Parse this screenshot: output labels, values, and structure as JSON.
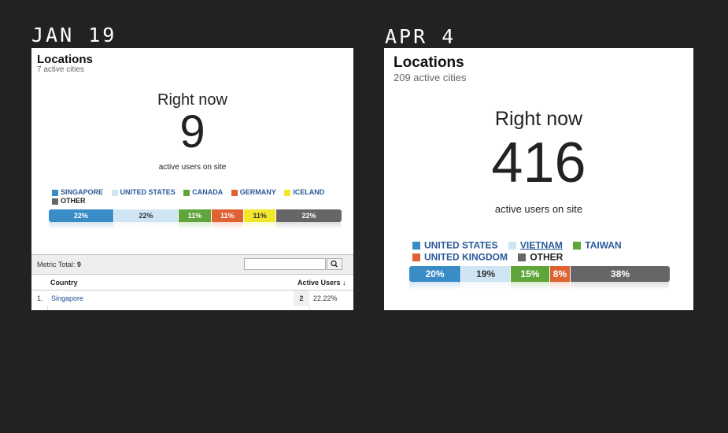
{
  "left": {
    "date": "JAN 19",
    "title": "Locations",
    "subtitle": "7 active cities",
    "right_now_title": "Right now",
    "right_now_value": "9",
    "right_now_caption": "active users on site",
    "legend": [
      {
        "label": "SINGAPORE",
        "color": "#3a8cc6",
        "text_color": "#2a5a9a"
      },
      {
        "label": "UNITED STATES",
        "color": "#cfe5f4",
        "text_color": "#2a5a9a"
      },
      {
        "label": "CANADA",
        "color": "#5fa53a",
        "text_color": "#2a5a9a"
      },
      {
        "label": "GERMANY",
        "color": "#df6232",
        "text_color": "#2a5a9a"
      },
      {
        "label": "ICELAND",
        "color": "#f2e82b",
        "text_color": "#2a5a9a"
      },
      {
        "label": "OTHER",
        "color": "#666666",
        "text_color": "#222222"
      }
    ],
    "bar": [
      {
        "label": "22%",
        "value": 22.22,
        "color": "#3a8cc6",
        "text_color": "#ffffff"
      },
      {
        "label": "22%",
        "value": 22.22,
        "color": "#cfe5f4",
        "text_color": "#333333"
      },
      {
        "label": "11%",
        "value": 11.11,
        "color": "#5fa53a",
        "text_color": "#ffffff"
      },
      {
        "label": "11%",
        "value": 11.11,
        "color": "#df6232",
        "text_color": "#ffffff"
      },
      {
        "label": "11%",
        "value": 11.11,
        "color": "#f2e82b",
        "text_color": "#333333"
      },
      {
        "label": "22%",
        "value": 22.22,
        "color": "#666666",
        "text_color": "#ffffff"
      }
    ],
    "table": {
      "metric_label": "Metric Total:",
      "metric_total": "9",
      "col_country": "Country",
      "col_active": "Active Users ↓",
      "rows": [
        {
          "index": "1.",
          "country": "Singapore",
          "count": "2",
          "percent": "22.22%"
        }
      ]
    }
  },
  "right": {
    "date": "APR 4",
    "title": "Locations",
    "subtitle": "209 active cities",
    "right_now_title": "Right now",
    "right_now_value": "416",
    "right_now_caption": "active users on site",
    "legend": [
      {
        "label": "UNITED STATES",
        "color": "#3a8cc6",
        "text_color": "#2a5a9a",
        "underline": false
      },
      {
        "label": "VIETNAM",
        "color": "#cfe5f4",
        "text_color": "#2a5a9a",
        "underline": true
      },
      {
        "label": "TAIWAN",
        "color": "#5fa53a",
        "text_color": "#2a5a9a",
        "underline": false
      },
      {
        "label": "UNITED KINGDOM",
        "color": "#df6232",
        "text_color": "#2a5a9a",
        "underline": false
      },
      {
        "label": "OTHER",
        "color": "#666666",
        "text_color": "#222222",
        "underline": false
      }
    ],
    "bar": [
      {
        "label": "20%",
        "value": 20,
        "color": "#3a8cc6",
        "text_color": "#ffffff"
      },
      {
        "label": "19%",
        "value": 19,
        "color": "#cfe5f4",
        "text_color": "#333333"
      },
      {
        "label": "15%",
        "value": 15,
        "color": "#5fa53a",
        "text_color": "#ffffff"
      },
      {
        "label": "8%",
        "value": 8,
        "color": "#df6232",
        "text_color": "#ffffff"
      },
      {
        "label": "38%",
        "value": 38,
        "color": "#666666",
        "text_color": "#ffffff"
      }
    ]
  }
}
